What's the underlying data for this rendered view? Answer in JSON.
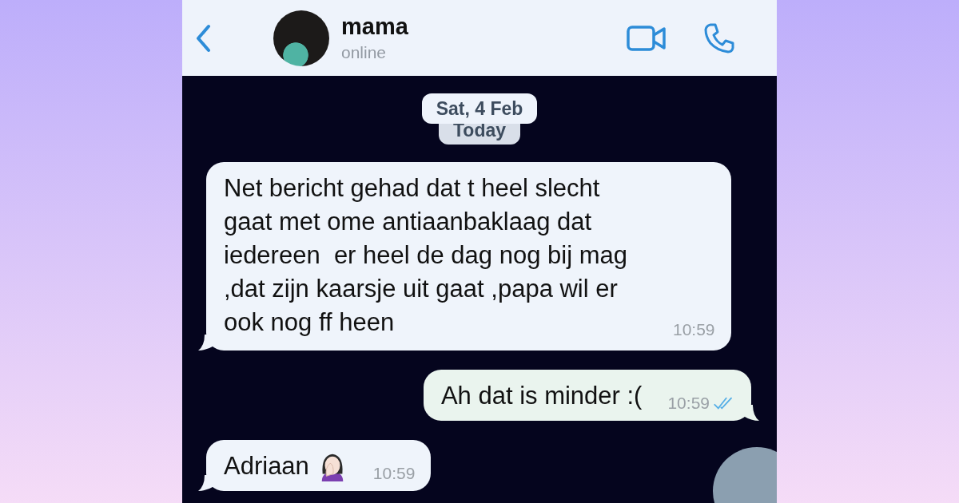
{
  "header": {
    "contact_name": "mama",
    "status": "online"
  },
  "date_chips": [
    "Sat, 4 Feb",
    "Today"
  ],
  "messages": [
    {
      "kind": "incoming",
      "text": "Net bericht gehad dat t heel slecht gaat met ome antiaanbaklaag dat iedereen  er heel de dag nog bij mag ,dat zijn kaarsje uit gaat ,papa wil er ook nog ff heen",
      "time": "10:59"
    },
    {
      "kind": "outgoing",
      "text": "Ah dat is minder :(",
      "time": "10:59",
      "read": true
    },
    {
      "kind": "incoming",
      "text": "Adriaan",
      "time": "10:59",
      "emoji": true
    }
  ]
}
